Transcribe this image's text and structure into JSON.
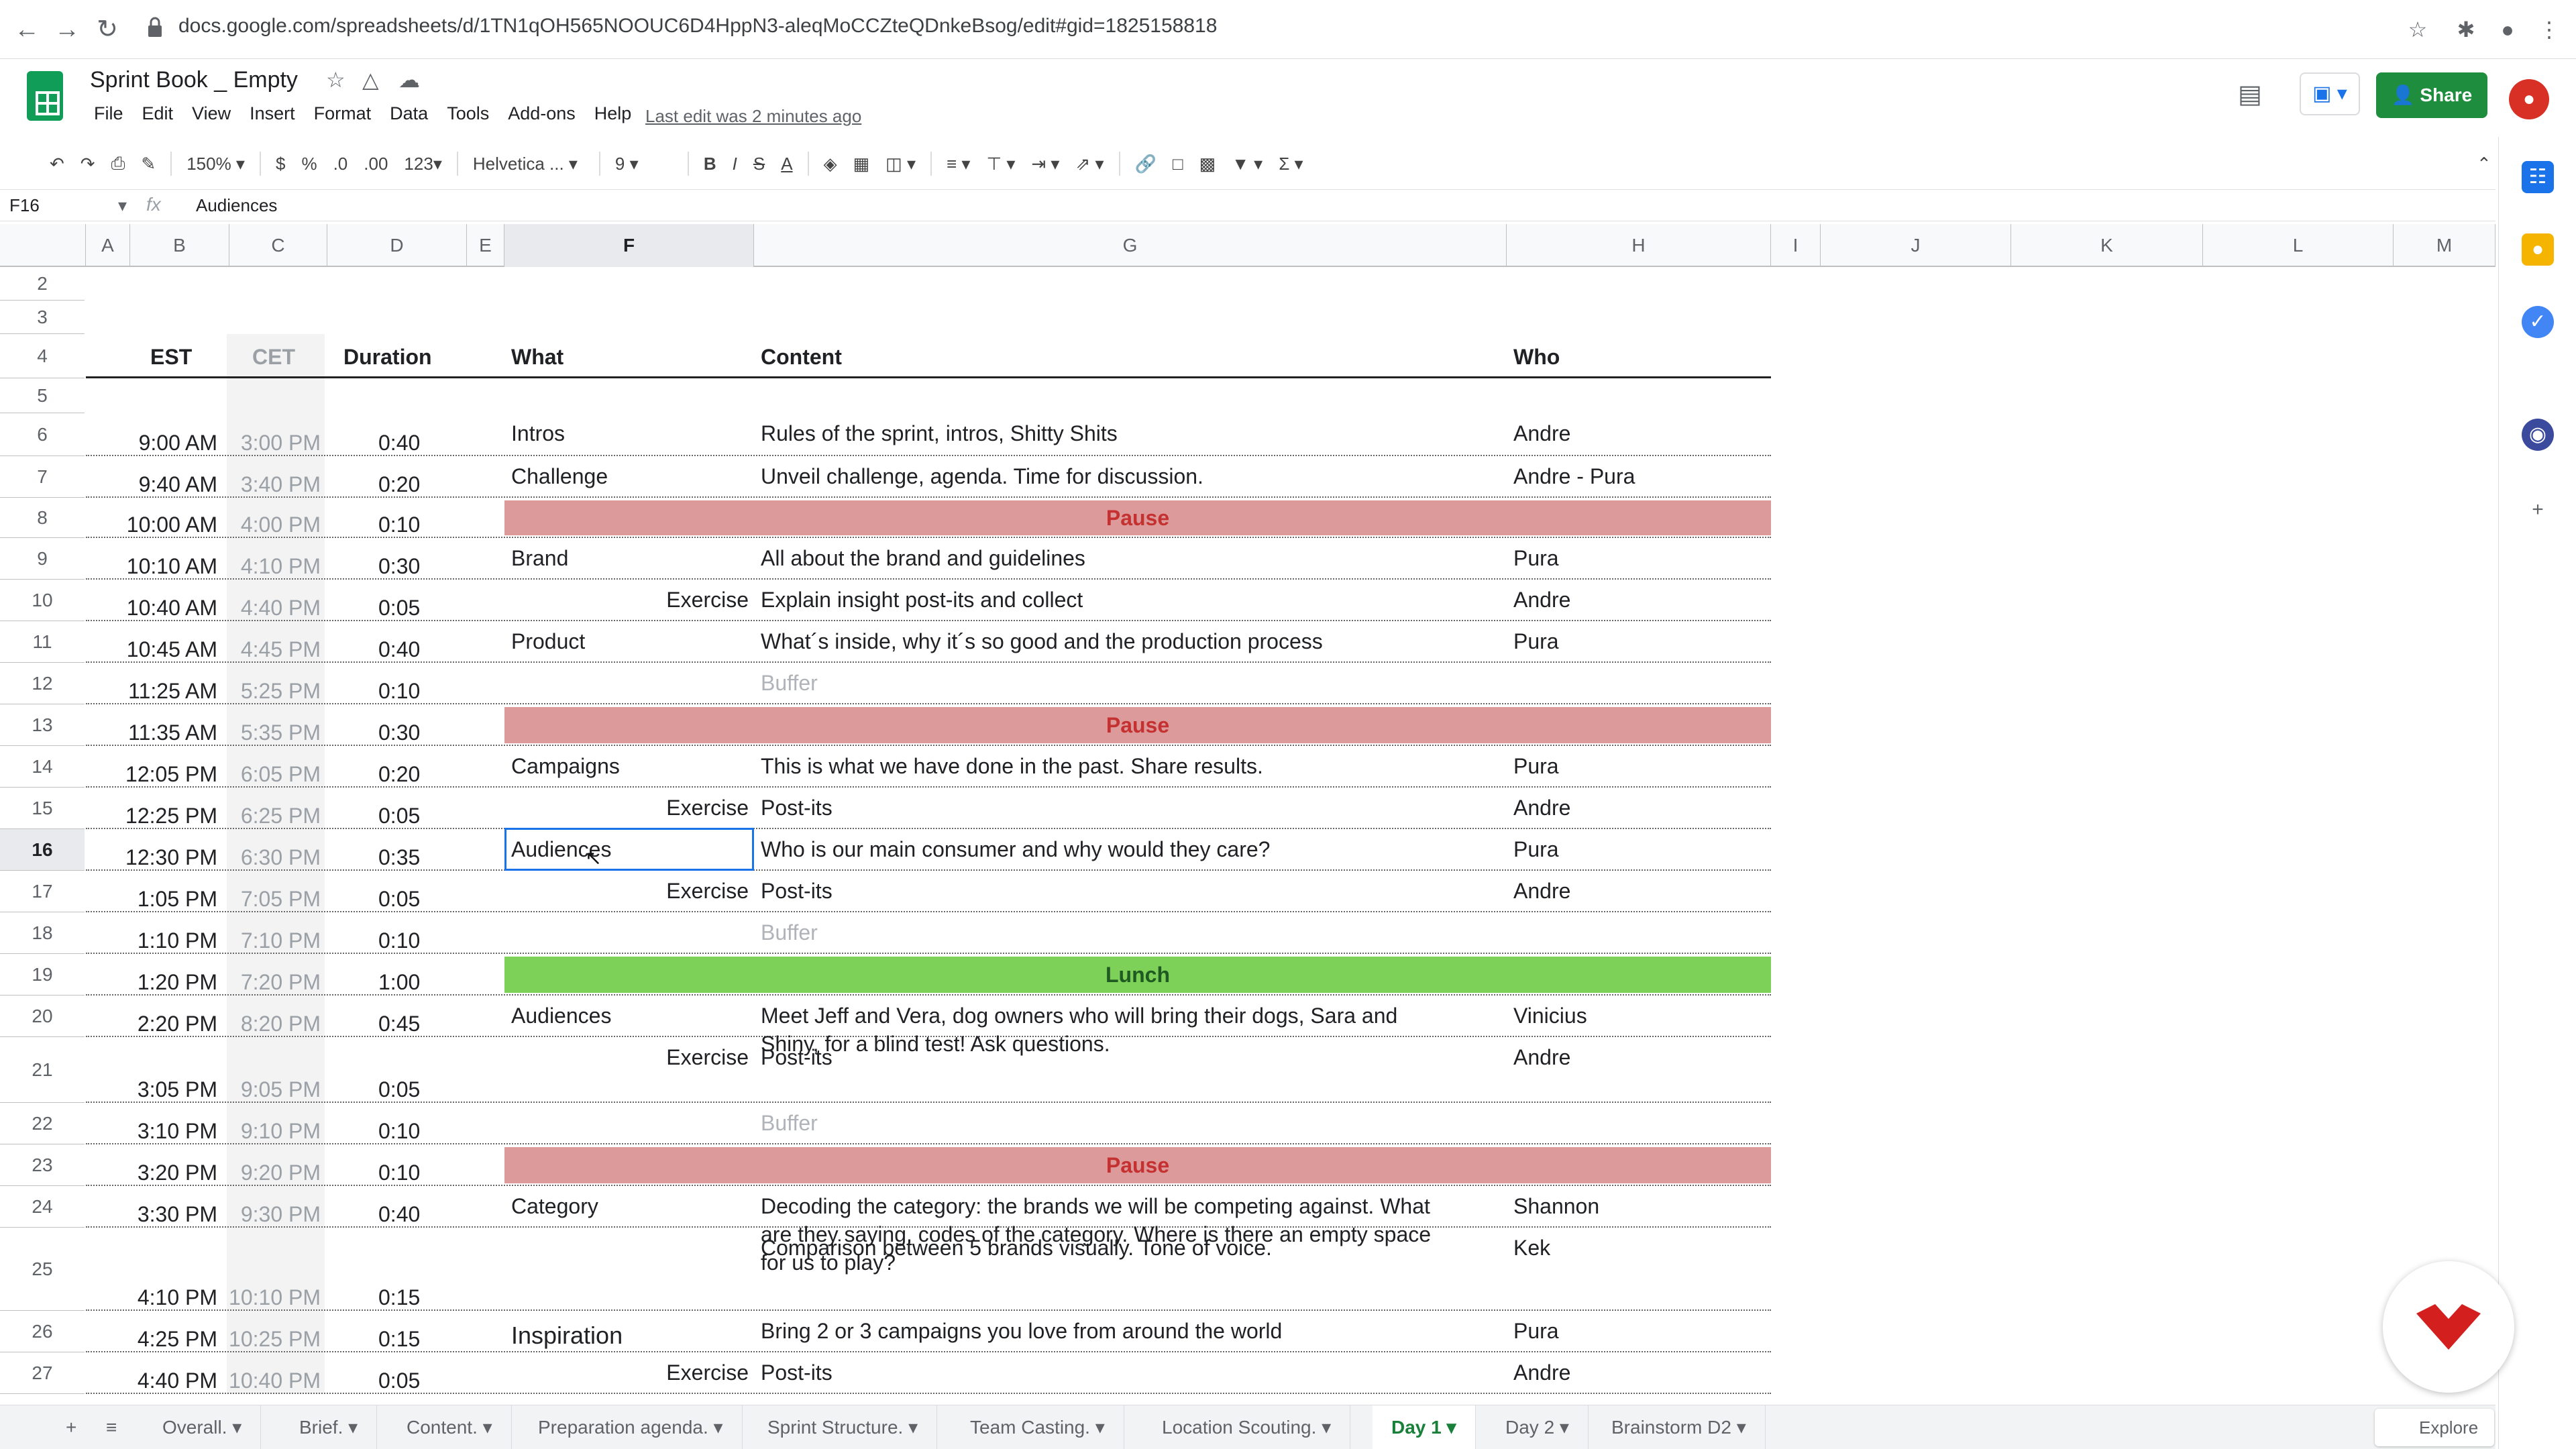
{
  "browser": {
    "url": "docs.google.com/spreadsheets/d/1TN1qOH565NOOUC6D4HppN3-aleqMoCCZteQDnkeBsog/edit#gid=1825158818"
  },
  "doc": {
    "title": "Sprint Book _ Empty",
    "menus": [
      "File",
      "Edit",
      "View",
      "Insert",
      "Format",
      "Data",
      "Tools",
      "Add-ons",
      "Help"
    ],
    "last_edit": "Last edit was 2 minutes ago",
    "share_label": "Share"
  },
  "toolbar": {
    "zoom": "150%",
    "currency": "$",
    "percent": "%",
    "dec_less": ".0",
    "dec_more": ".00",
    "format_more": "123",
    "font": "Helvetica ...",
    "font_size": "9",
    "bold": "B",
    "italic": "I",
    "strike": "S",
    "text_color": "A"
  },
  "formula": {
    "cell_ref": "F16",
    "content": "Audiences"
  },
  "columns": [
    "A",
    "B",
    "C",
    "D",
    "E",
    "F",
    "G",
    "H",
    "I",
    "J",
    "K",
    "L",
    "M"
  ],
  "header_row": {
    "est": "EST",
    "cet": "CET",
    "duration": "Duration",
    "what": "What",
    "content": "Content",
    "who": "Who"
  },
  "rows": [
    {
      "n": "2"
    },
    {
      "n": "3"
    },
    {
      "n": "4"
    },
    {
      "n": "5"
    },
    {
      "n": "6",
      "est": "9:00 AM",
      "cet": "3:00 PM",
      "dur": "0:40",
      "what": "Intros",
      "content": "Rules of the sprint, intros, Shitty Shits",
      "who": "Andre"
    },
    {
      "n": "7",
      "est": "9:40 AM",
      "cet": "3:40 PM",
      "dur": "0:20",
      "what": "Challenge",
      "content": "Unveil challenge, agenda. Time for discussion.",
      "who": "Andre - Pura"
    },
    {
      "n": "8",
      "est": "10:00 AM",
      "cet": "4:00 PM",
      "dur": "0:10",
      "band": "Pause"
    },
    {
      "n": "9",
      "est": "10:10 AM",
      "cet": "4:10 PM",
      "dur": "0:30",
      "what": "Brand",
      "content": "All about the brand and guidelines",
      "who": "Pura"
    },
    {
      "n": "10",
      "est": "10:40 AM",
      "cet": "4:40 PM",
      "dur": "0:05",
      "exercise": "Exercise",
      "content": "Explain insight post-its and collect",
      "who": "Andre"
    },
    {
      "n": "11",
      "est": "10:45 AM",
      "cet": "4:45 PM",
      "dur": "0:40",
      "what": "Product",
      "content": "What´s inside, why it´s so good and the production process",
      "who": "Pura"
    },
    {
      "n": "12",
      "est": "11:25 AM",
      "cet": "5:25 PM",
      "dur": "0:10",
      "buffer": "Buffer"
    },
    {
      "n": "13",
      "est": "11:35 AM",
      "cet": "5:35 PM",
      "dur": "0:30",
      "band": "Pause"
    },
    {
      "n": "14",
      "est": "12:05 PM",
      "cet": "6:05 PM",
      "dur": "0:20",
      "what": "Campaigns",
      "content": "This is what we have done in the past. Share results.",
      "who": "Pura"
    },
    {
      "n": "15",
      "est": "12:25 PM",
      "cet": "6:25 PM",
      "dur": "0:05",
      "exercise": "Exercise",
      "content": "Post-its",
      "who": "Andre"
    },
    {
      "n": "16",
      "est": "12:30 PM",
      "cet": "6:30 PM",
      "dur": "0:35",
      "what": "Audiences",
      "content": "Who is our main consumer and why would they care?",
      "who": "Pura"
    },
    {
      "n": "17",
      "est": "1:05 PM",
      "cet": "7:05 PM",
      "dur": "0:05",
      "exercise": "Exercise",
      "content": "Post-its",
      "who": "Andre"
    },
    {
      "n": "18",
      "est": "1:10 PM",
      "cet": "7:10 PM",
      "dur": "0:10",
      "buffer": "Buffer"
    },
    {
      "n": "19",
      "est": "1:20 PM",
      "cet": "7:20 PM",
      "dur": "1:00",
      "band": "Lunch"
    },
    {
      "n": "20",
      "est": "2:20 PM",
      "cet": "8:20 PM",
      "dur": "0:45",
      "what": "Audiences",
      "content": "Meet Jeff and Vera, dog owners who will bring their dogs, Sara and",
      "content2": "Shiny, for a blind test! Ask questions.",
      "who": "Vinicius"
    },
    {
      "n": "21",
      "est": "3:05 PM",
      "cet": "9:05 PM",
      "dur": "0:05",
      "exercise": "Exercise",
      "content": "Post-its",
      "who": "Andre"
    },
    {
      "n": "22",
      "est": "3:10 PM",
      "cet": "9:10 PM",
      "dur": "0:10",
      "buffer": "Buffer"
    },
    {
      "n": "23",
      "est": "3:20 PM",
      "cet": "9:20 PM",
      "dur": "0:10",
      "band": "Pause"
    },
    {
      "n": "24",
      "est": "3:30 PM",
      "cet": "9:30 PM",
      "dur": "0:40",
      "what": "Category",
      "content": "Decoding the category: the brands we will be competing against. What",
      "content2": "are they saying, codes of the category. Where is there an empty space",
      "content3": "for us to play?",
      "who": "Shannon"
    },
    {
      "n": "25",
      "est": "4:10 PM",
      "cet": "10:10 PM",
      "dur": "0:15",
      "content": "Comparison between 5 brands visually. Tone of voice.",
      "who": "Kek"
    },
    {
      "n": "26",
      "est": "4:25 PM",
      "cet": "10:25 PM",
      "dur": "0:15",
      "what": "Inspiration",
      "content": "Bring 2 or 3 campaigns you love from around the world",
      "who": "Pura"
    },
    {
      "n": "27",
      "est": "4:40 PM",
      "cet": "10:40 PM",
      "dur": "0:05",
      "exercise": "Exercise",
      "content": "Post-its",
      "who": "Andre"
    }
  ],
  "sheet_tabs": [
    "Overall.",
    "Brief.",
    "Content.",
    "Preparation agenda.",
    "Sprint Structure.",
    "Team Casting.",
    "Location Scouting.",
    "Day 1",
    "Day 2",
    "Brainstorm D2"
  ],
  "active_tab": "Day 1",
  "explore_label": "Explore",
  "colors": {
    "pause_bg": "#dd9a9a",
    "pause_text": "#c53030",
    "lunch_bg": "#7ed158",
    "share_green": "#1e8e3e",
    "selection_blue": "#1a73e8"
  }
}
